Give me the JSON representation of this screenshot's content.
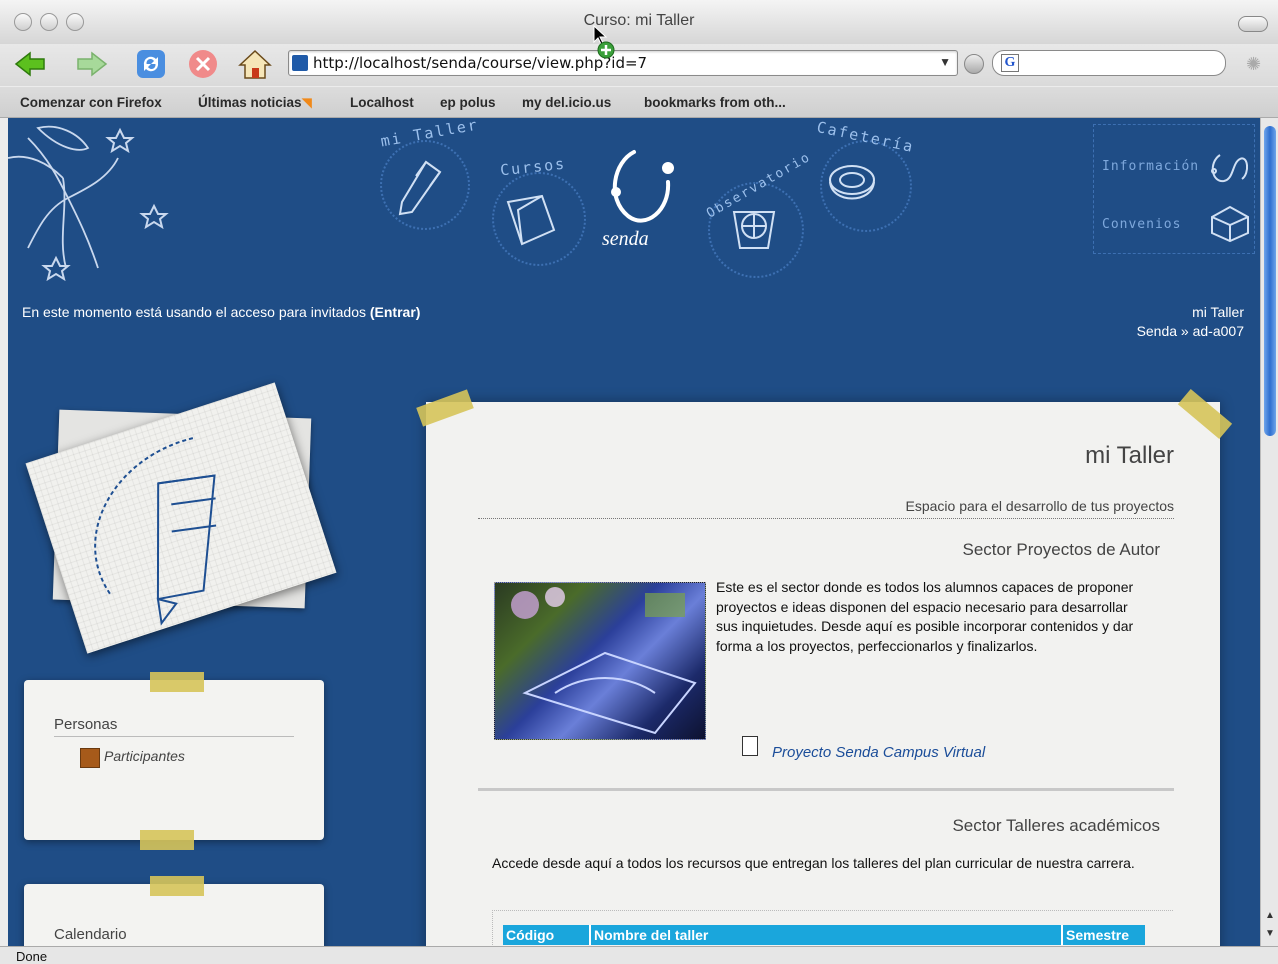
{
  "window": {
    "title": "Curso: mi Taller"
  },
  "toolbar": {
    "back_icon": "back-arrow-icon",
    "forward_icon": "forward-arrow-icon",
    "reload_icon": "reload-icon",
    "stop_icon": "stop-icon",
    "home_icon": "home-icon",
    "url": "http://localhost/senda/course/view.php?id=7",
    "search_engine": "G"
  },
  "bookmarks": [
    "Comenzar con Firefox",
    "Últimas noticias",
    "Localhost",
    "ep polus",
    "my del.icio.us",
    "bookmarks from oth..."
  ],
  "banner": {
    "nav": [
      "mi Taller",
      "Cursos",
      "Observatorio",
      "Cafetería"
    ],
    "logo_text": "senda",
    "right_nav": [
      "Información",
      "Convenios"
    ]
  },
  "header": {
    "guest_text": "En este momento está usando el acceso para invitados",
    "login_label": "(Entrar)",
    "course_name": "mi Taller",
    "breadcrumb": "Senda » ad-a007"
  },
  "sidebar": {
    "people_title": "Personas",
    "participants_label": "Participantes",
    "calendar_title": "Calendario"
  },
  "main": {
    "title": "mi Taller",
    "subtitle": "Espacio para el desarrollo de tus proyectos",
    "section1_title": "Sector Proyectos de Autor",
    "section1_text": "Este es el sector donde es todos los alumnos capaces de proponer proyectos e ideas disponen del espacio necesario para desarrollar sus inquietudes. Desde aquí es posible incorporar contenidos y dar forma a los proyectos, perfeccionarlos y finalizarlos.",
    "section1_link": "Proyecto Senda Campus Virtual",
    "section2_title": "Sector Talleres académicos",
    "section2_text": "Accede desde aquí a todos los recursos que entregan los talleres del plan curricular de nuestra carrera.",
    "table_headers": [
      "Código",
      "Nombre del taller",
      "Semestre"
    ]
  },
  "status": {
    "text": "Done"
  },
  "colors": {
    "background": "#1f4d86",
    "table_header": "#1aa6dc",
    "tape": "#d6c45a"
  }
}
